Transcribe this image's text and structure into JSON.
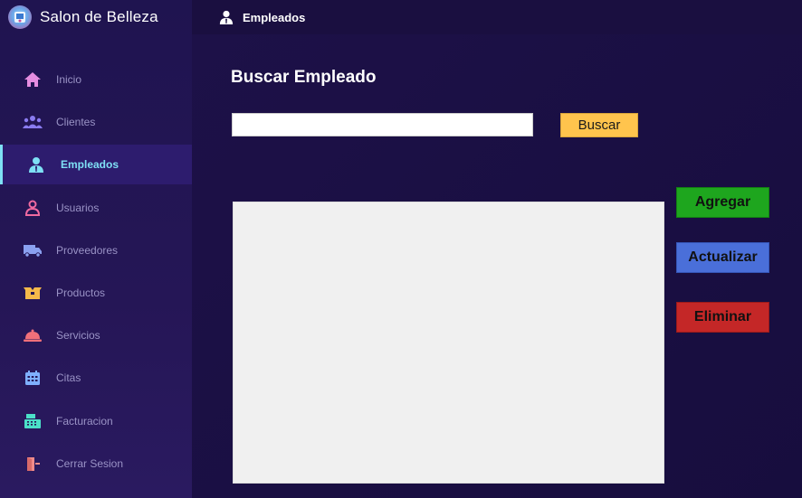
{
  "app": {
    "title": "Salon de Belleza"
  },
  "header": {
    "title": "Empleados",
    "icon": "employee-icon"
  },
  "sidebar": {
    "items": [
      {
        "label": "Inicio",
        "icon": "home-icon",
        "color": "#e58de0"
      },
      {
        "label": "Clientes",
        "icon": "clients-icon",
        "color": "#8a7bf0"
      },
      {
        "label": "Empleados",
        "icon": "employee-icon",
        "color": "#7ee0f5",
        "active": true
      },
      {
        "label": "Usuarios",
        "icon": "user-icon",
        "color": "#f06aa0"
      },
      {
        "label": "Proveedores",
        "icon": "truck-icon",
        "color": "#8aa0f0"
      },
      {
        "label": "Productos",
        "icon": "box-icon",
        "color": "#f5b94a"
      },
      {
        "label": "Servicios",
        "icon": "bell-icon",
        "color": "#f0707a"
      },
      {
        "label": "Citas",
        "icon": "calendar-icon",
        "color": "#7fb0ff"
      },
      {
        "label": "Facturacion",
        "icon": "cash-register-icon",
        "color": "#4be0c8"
      },
      {
        "label": "Cerrar Sesion",
        "icon": "logout-icon",
        "color": "#f08a8a"
      }
    ]
  },
  "main": {
    "section_title": "Buscar Empleado",
    "search": {
      "value": "",
      "placeholder": ""
    },
    "search_button": "Buscar",
    "actions": {
      "add": "Agregar",
      "update": "Actualizar",
      "delete": "Eliminar"
    }
  },
  "colors": {
    "accent": "#7ee0f5",
    "search_button": "#ffc44d",
    "add_button": "#1ea61e",
    "update_button": "#4a6fd9",
    "delete_button": "#c42727"
  }
}
